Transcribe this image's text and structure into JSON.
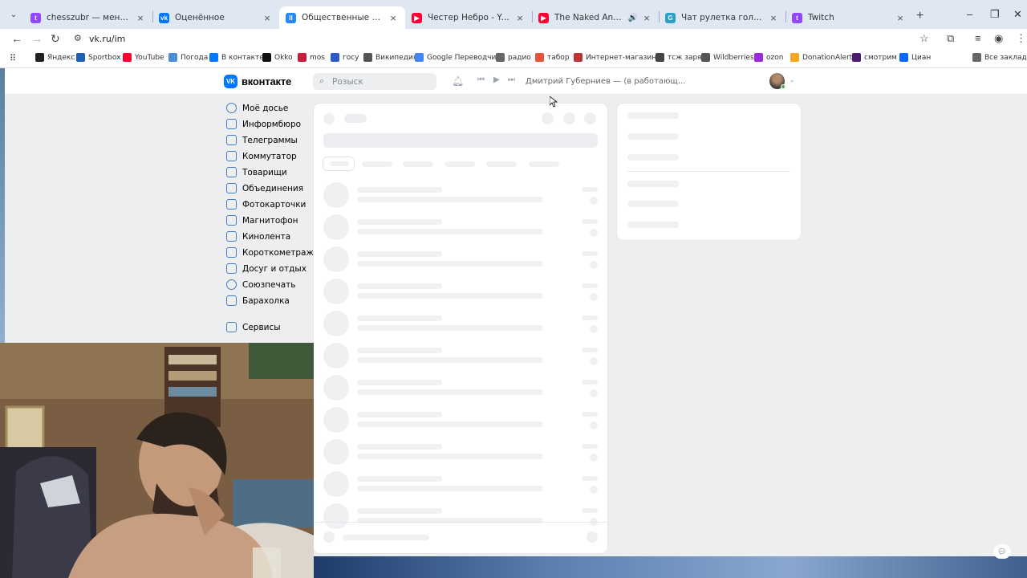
{
  "browser": {
    "tabs": [
      {
        "label": "chesszubr — менеджер клипов",
        "color": "#9146ff",
        "glyph": "t"
      },
      {
        "label": "Оценённое",
        "color": "#0077ff",
        "glyph": "vk"
      },
      {
        "label": "Общественные звукозаписи",
        "color": "#2787f5",
        "glyph": "II"
      },
      {
        "label": "Честер Небро - YouTube",
        "color": "#ff0033",
        "glyph": "▶"
      },
      {
        "label": "The Naked And Famous - H",
        "color": "#ff0033",
        "glyph": "▶"
      },
      {
        "label": "Чат рулетка голосовая — Nek",
        "color": "#2aa0c8",
        "glyph": "G"
      },
      {
        "label": "Twitch",
        "color": "#9146ff",
        "glyph": "t"
      }
    ],
    "url": "vk.ru/im",
    "bookmarks": [
      {
        "label": "Яндекс",
        "color": "#222"
      },
      {
        "label": "Sportbox",
        "color": "#1f5fb4"
      },
      {
        "label": "YouTube",
        "color": "#ff0033"
      },
      {
        "label": "Погода",
        "color": "#4a8fd6"
      },
      {
        "label": "В контакте",
        "color": "#0077ff"
      },
      {
        "label": "Okko",
        "color": "#111"
      },
      {
        "label": "mos",
        "color": "#c81d3c"
      },
      {
        "label": "госу",
        "color": "#2d5ac8"
      },
      {
        "label": "Википедия",
        "color": "#555"
      },
      {
        "label": "Google Переводчик",
        "color": "#4285f4"
      },
      {
        "label": "радио",
        "color": "#666"
      },
      {
        "label": "табор",
        "color": "#e5533d"
      },
      {
        "label": "Интернет-магазин...",
        "color": "#b33"
      },
      {
        "label": "тсж заря",
        "color": "#444"
      },
      {
        "label": "Wildberries",
        "color": "#555"
      },
      {
        "label": "ozon",
        "color": "#9a2bd8"
      },
      {
        "label": "DonationAlerts",
        "color": "#f5a623"
      },
      {
        "label": "смотрим",
        "color": "#4b1c6e"
      },
      {
        "label": "Циан",
        "color": "#0468ff"
      },
      {
        "label": "Все закладки",
        "color": "#666"
      }
    ]
  },
  "vk": {
    "logo_text": "вконтакте",
    "search_placeholder": "Розыск",
    "player_track": "Дмитрий Губерниев — (в работающ...",
    "menu": [
      "Моё досье",
      "Информбюро",
      "Телеграммы",
      "Коммутатор",
      "Товарищи",
      "Объединения",
      "Фотокарточки",
      "Магнитофон",
      "Кинолента",
      "Короткометражки",
      "Досуг и отдых",
      "Союзпечать",
      "Барахолка",
      "Сервисы"
    ]
  }
}
